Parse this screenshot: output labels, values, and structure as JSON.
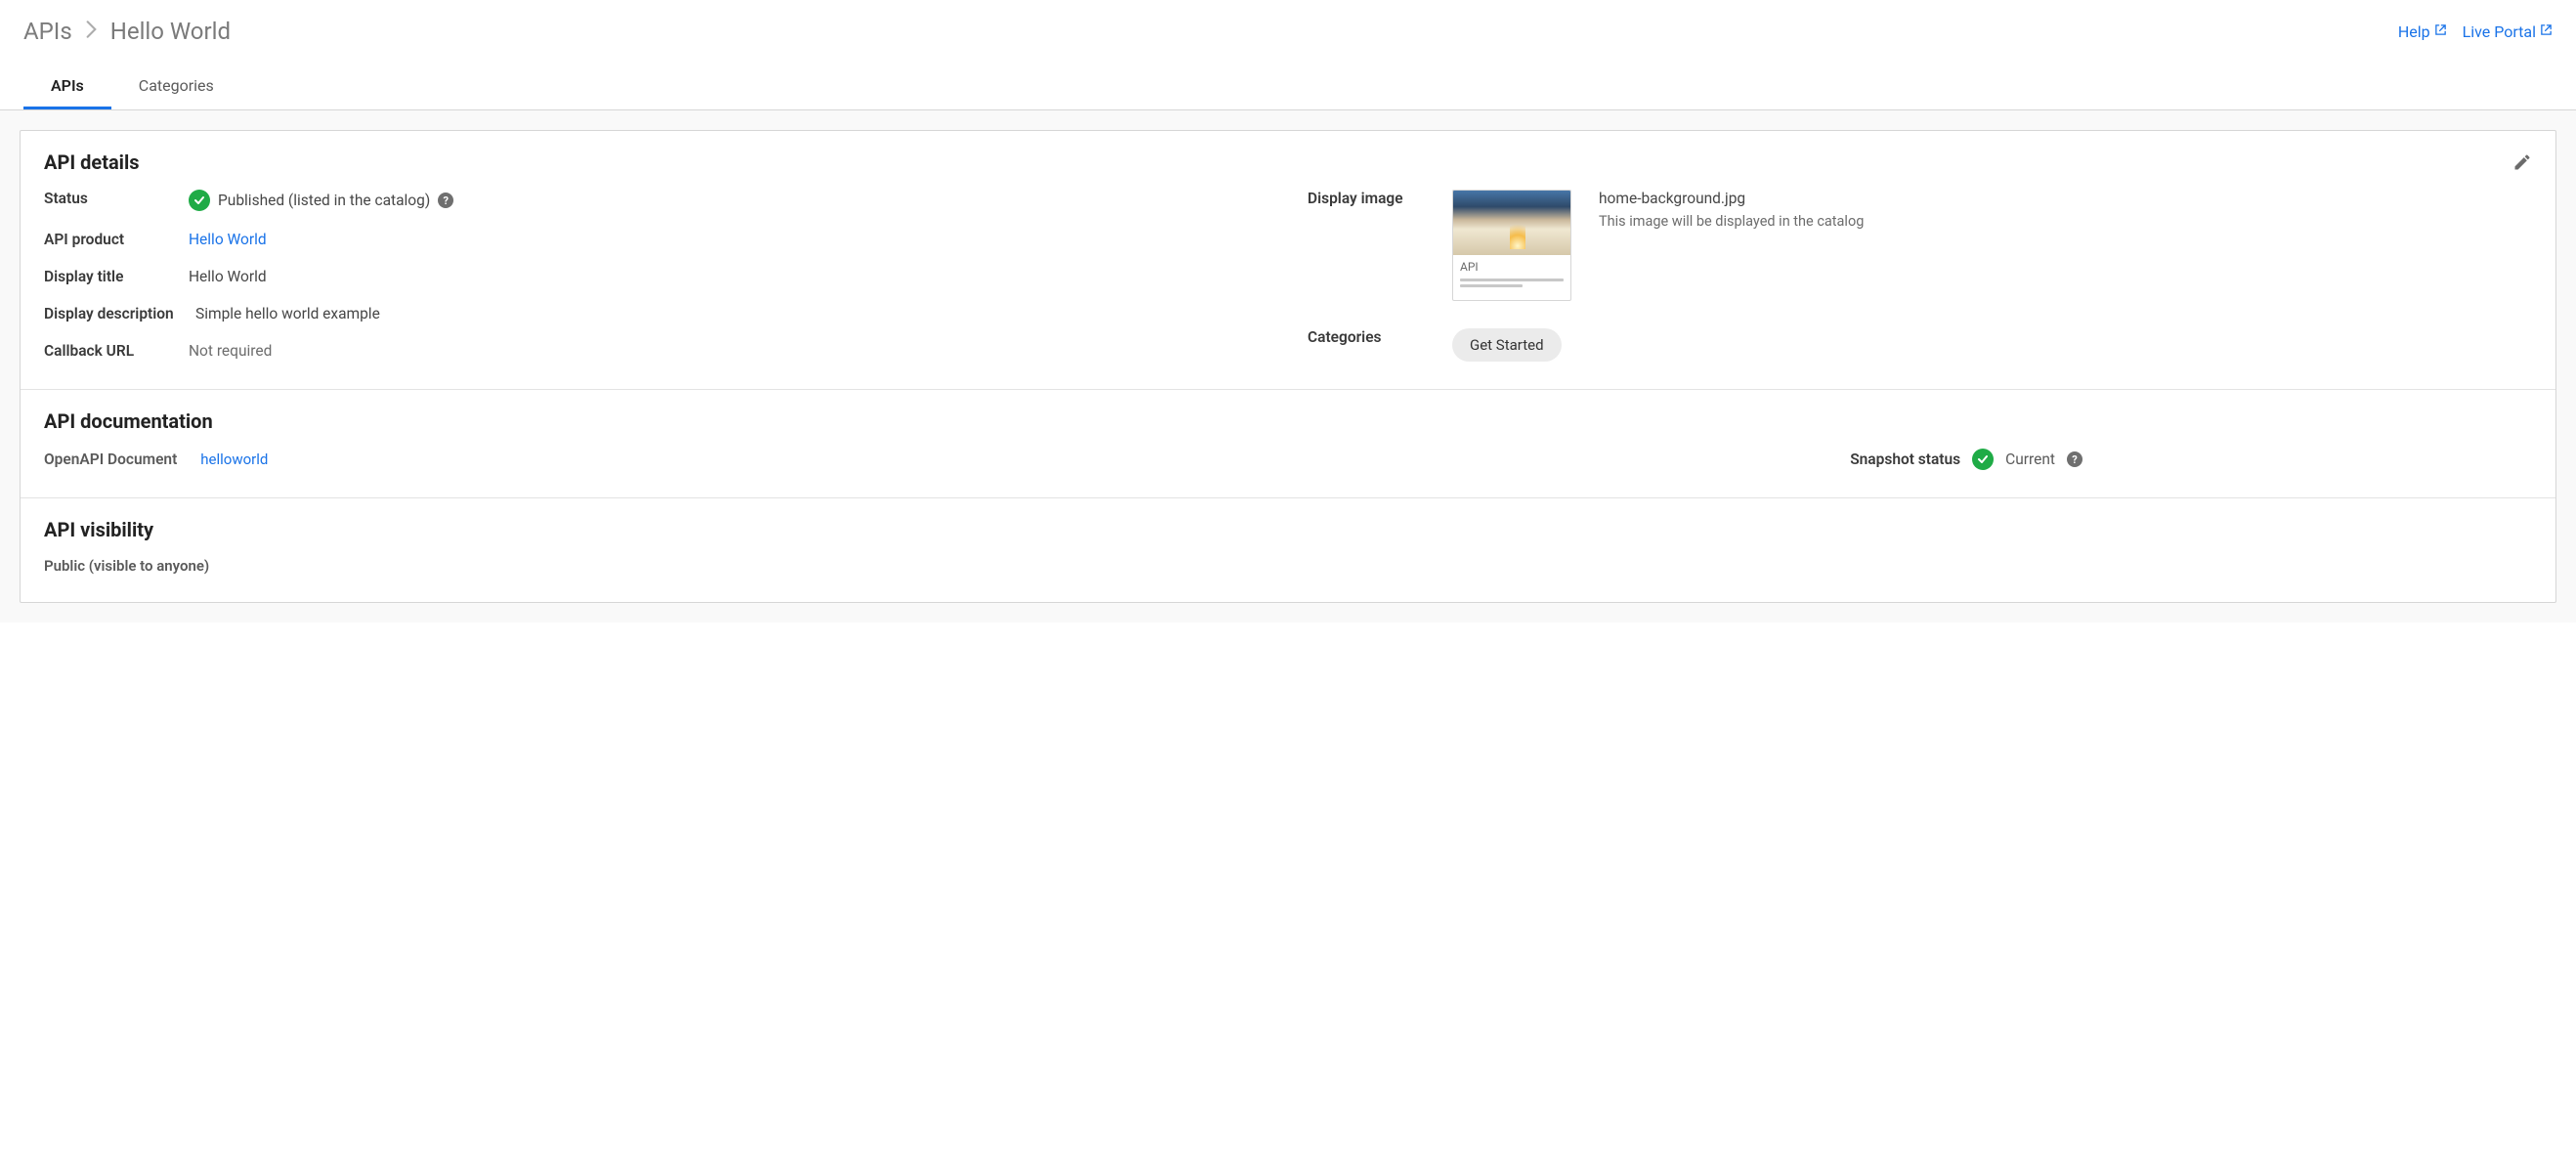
{
  "breadcrumb": {
    "root": "APIs",
    "current": "Hello World"
  },
  "header_links": {
    "help": "Help",
    "live_portal": "Live Portal"
  },
  "tabs": {
    "apis": "APIs",
    "categories": "Categories"
  },
  "details": {
    "section_title": "API details",
    "labels": {
      "status": "Status",
      "api_product": "API product",
      "display_title": "Display title",
      "display_description": "Display description",
      "callback_url": "Callback URL",
      "display_image": "Display image",
      "categories": "Categories"
    },
    "values": {
      "status": "Published (listed in the catalog)",
      "api_product": "Hello World",
      "display_title": "Hello World",
      "display_description": "Simple hello world example",
      "callback_url": "Not required"
    },
    "image": {
      "card_caption": "API",
      "filename": "home-background.jpg",
      "description": "This image will be displayed in the catalog"
    },
    "category_chip": "Get Started"
  },
  "documentation": {
    "section_title": "API documentation",
    "label": "OpenAPI Document",
    "link": "helloworld",
    "snapshot_label": "Snapshot status",
    "snapshot_value": "Current"
  },
  "visibility": {
    "section_title": "API visibility",
    "value": "Public (visible to anyone)"
  }
}
